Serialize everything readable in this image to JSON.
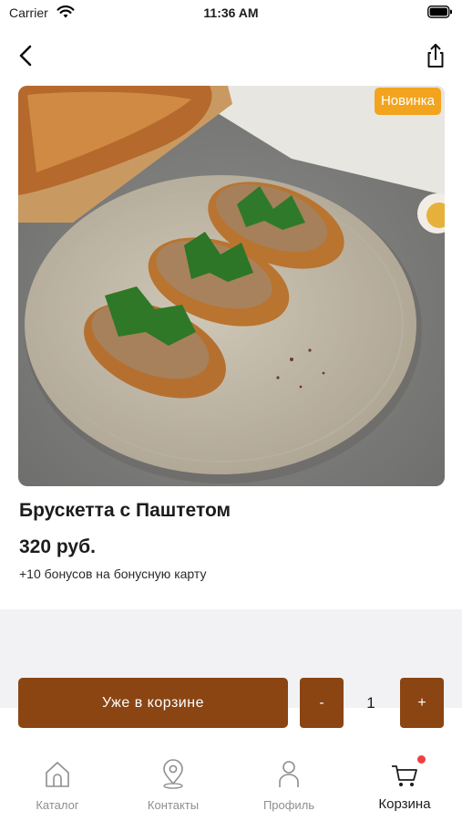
{
  "status_bar": {
    "carrier": "Carrier",
    "time": "11:36 AM",
    "icons": [
      "wifi-icon",
      "battery-icon"
    ]
  },
  "nav": {
    "icons": [
      "back-icon",
      "share-icon"
    ]
  },
  "product": {
    "badge": "Новинка",
    "title": "Брускетта с Паштетом",
    "price": "320 руб.",
    "bonus": "+10 бонусов на бонусную карту"
  },
  "actions": {
    "in_cart_label": "Уже в корзине",
    "minus_label": "-",
    "quantity": "1",
    "plus_label": "+"
  },
  "tabs": [
    {
      "label": "Каталог",
      "icon": "home-icon",
      "active": false
    },
    {
      "label": "Контакты",
      "icon": "location-pin-icon",
      "active": false
    },
    {
      "label": "Профиль",
      "icon": "person-icon",
      "active": false
    },
    {
      "label": "Корзина",
      "icon": "cart-icon",
      "active": true,
      "has_notification_dot": true
    }
  ],
  "colors": {
    "accent": "#8a4513",
    "badge": "#f3a41f",
    "notification_dot": "#ef4040",
    "band": "#f2f2f4",
    "inactive_tab": "#8e8e93"
  }
}
